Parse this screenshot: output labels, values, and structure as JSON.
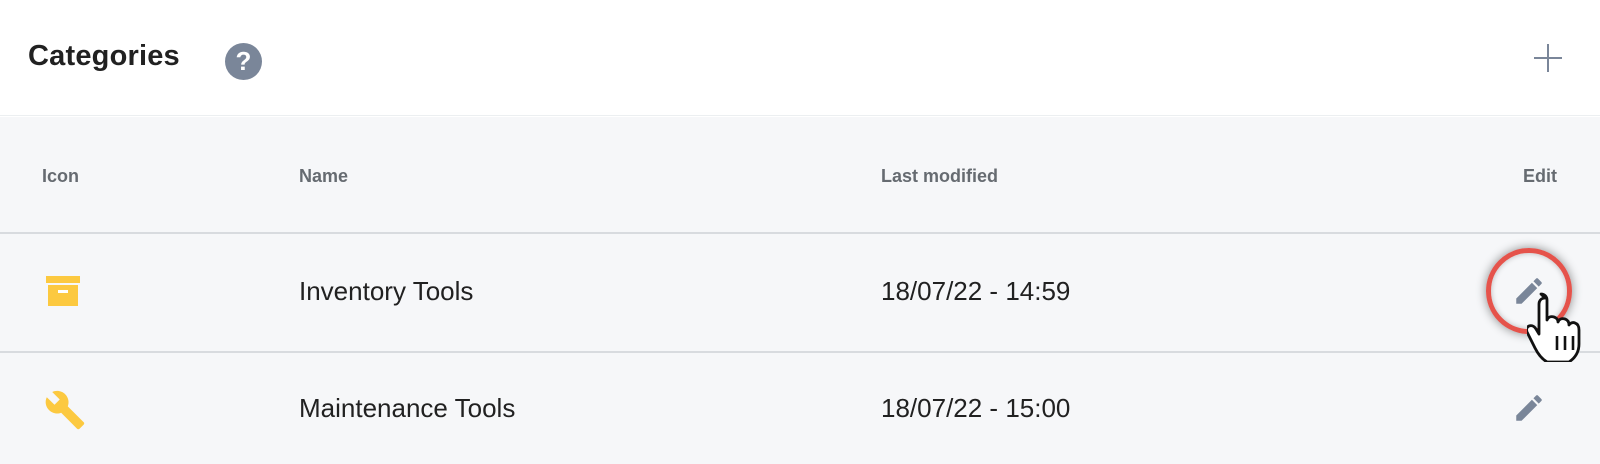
{
  "header": {
    "title": "Categories",
    "help_icon": "help-circle-icon",
    "add_icon": "plus-icon"
  },
  "table": {
    "columns": {
      "icon": "Icon",
      "name": "Name",
      "last_modified": "Last modified",
      "edit": "Edit"
    },
    "rows": [
      {
        "icon": "archive-box-icon",
        "name": "Inventory Tools",
        "last_modified": "18/07/22 - 14:59",
        "edit_icon": "pencil-icon",
        "highlighted": true
      },
      {
        "icon": "wrench-icon",
        "name": "Maintenance Tools",
        "last_modified": "18/07/22 - 15:00",
        "edit_icon": "pencil-icon",
        "highlighted": false
      }
    ]
  },
  "colors": {
    "accent_icon": "#7a8699",
    "category_icon": "#fcc940",
    "highlight": "#e5534b"
  }
}
